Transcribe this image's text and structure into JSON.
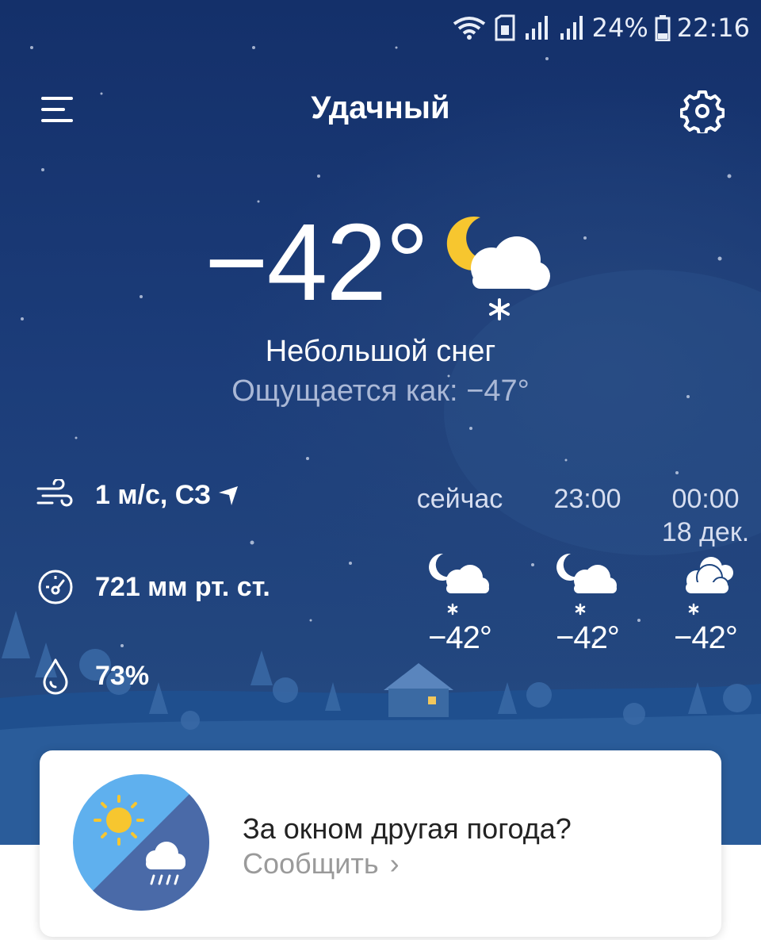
{
  "status_bar": {
    "battery": "24%",
    "time": "22:16",
    "icons": [
      "wifi-icon",
      "sim-icon",
      "signal-icon",
      "signal-icon",
      "battery-icon"
    ]
  },
  "header": {
    "city": "Удачный",
    "menu_icon": "menu-icon",
    "settings_icon": "gear-icon"
  },
  "current": {
    "temperature": "−42°",
    "condition": "Небольшой снег",
    "feels_like": "Ощущается как: −47°",
    "icon": "moon-cloud-snow-icon"
  },
  "details": {
    "wind": "1 м/с, СЗ",
    "pressure": "721 мм рт. ст.",
    "humidity": "73%"
  },
  "hourly": [
    {
      "time": "сейчас",
      "date": "",
      "temp": "−42°",
      "icon": "moon-cloud-snow-icon"
    },
    {
      "time": "23:00",
      "date": "",
      "temp": "−42°",
      "icon": "moon-cloud-snow-icon"
    },
    {
      "time": "00:00",
      "date": "18 дек.",
      "temp": "−42°",
      "icon": "cloud-snow-icon"
    }
  ],
  "feedback_card": {
    "question": "За окном другая погода?",
    "action": "Сообщить"
  },
  "colors": {
    "sky_top": "#14306a",
    "sky_bottom": "#2a5288",
    "sun": "#f7c62f",
    "illus_light": "#5fb0ee",
    "illus_dark": "#4a6aa8"
  }
}
